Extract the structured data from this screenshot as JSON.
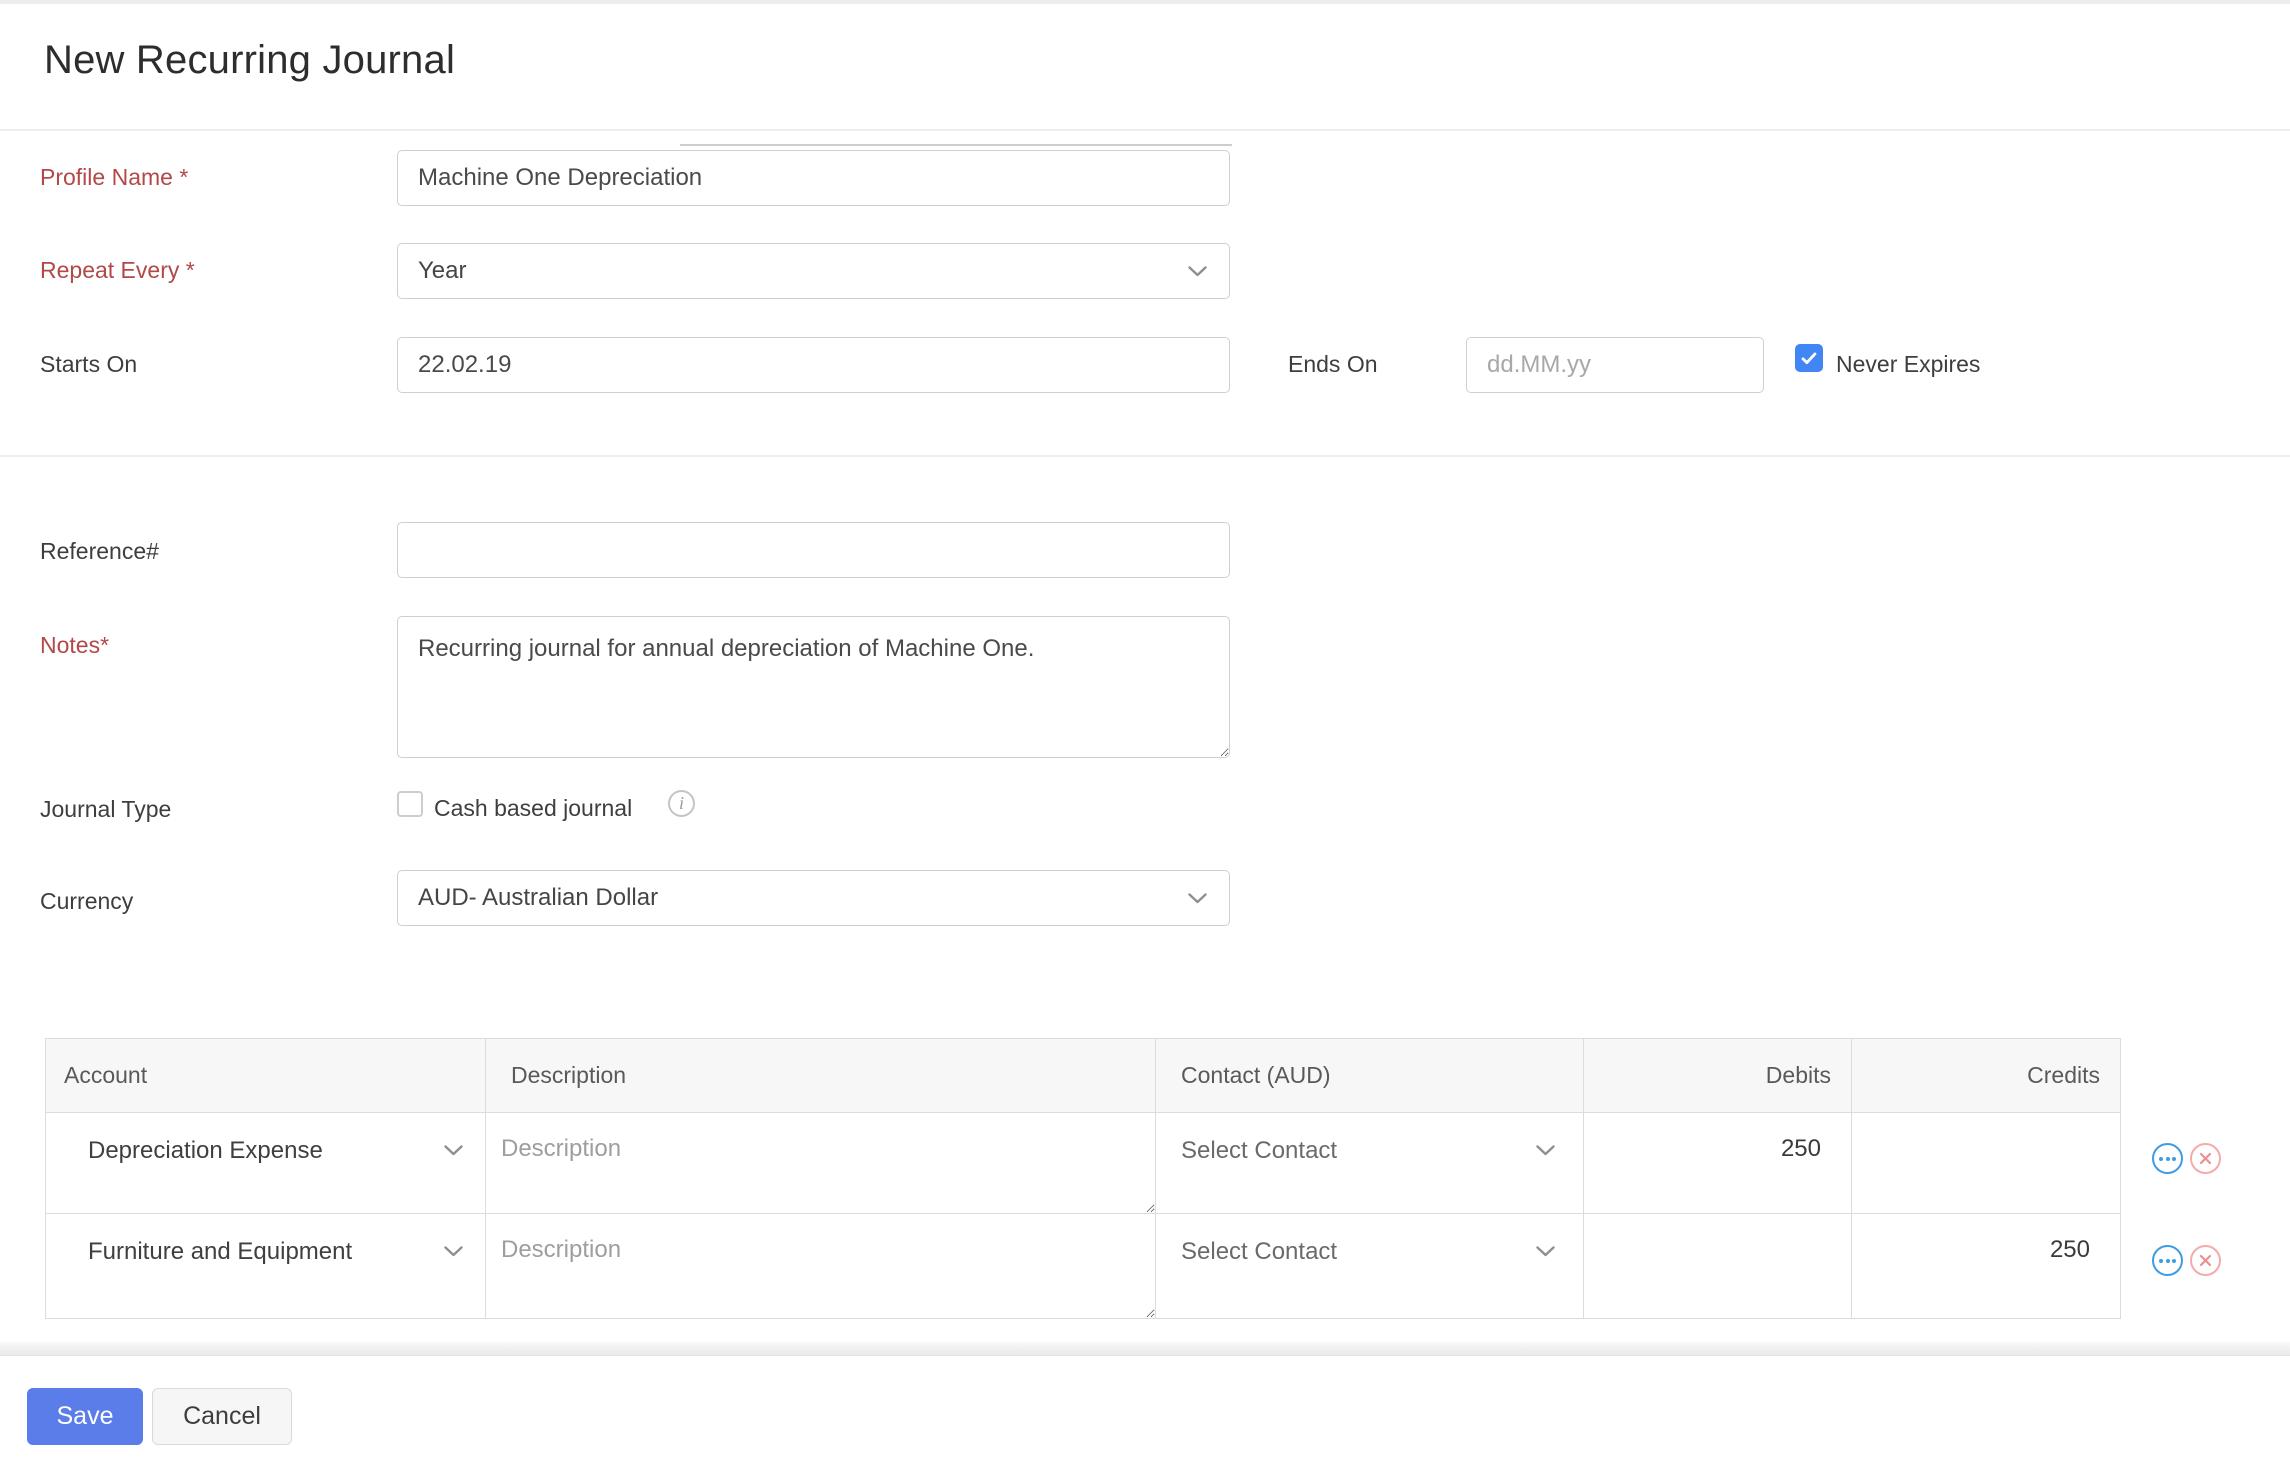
{
  "header": {
    "title": "New Recurring Journal"
  },
  "form": {
    "profile_name": {
      "label": "Profile Name *",
      "value": "Machine One Depreciation"
    },
    "repeat_every": {
      "label": "Repeat Every *",
      "value": "Year"
    },
    "starts_on": {
      "label": "Starts On",
      "value": "22.02.19"
    },
    "ends_on": {
      "label": "Ends On",
      "placeholder": "dd.MM.yy",
      "value": ""
    },
    "never_expires": {
      "label": "Never Expires",
      "checked": true
    },
    "reference": {
      "label": "Reference#",
      "value": ""
    },
    "notes": {
      "label": "Notes*",
      "value": "Recurring journal for annual depreciation of Machine One."
    },
    "journal_type": {
      "label": "Journal Type",
      "checkbox_label": "Cash based journal",
      "checked": false
    },
    "currency": {
      "label": "Currency",
      "value": "AUD- Australian Dollar"
    }
  },
  "table": {
    "headers": {
      "account": "Account",
      "description": "Description",
      "contact": "Contact (AUD)",
      "debits": "Debits",
      "credits": "Credits"
    },
    "rows": [
      {
        "account": "Depreciation Expense",
        "description_placeholder": "Description",
        "contact": "Select Contact",
        "debits": "250",
        "credits": ""
      },
      {
        "account": "Furniture and Equipment",
        "description_placeholder": "Description",
        "contact": "Select Contact",
        "debits": "",
        "credits": "250"
      }
    ]
  },
  "footer": {
    "save": "Save",
    "cancel": "Cancel"
  },
  "colors": {
    "required_label": "#b24848",
    "primary_button": "#5a7dea",
    "checkbox_checked": "#4285f4",
    "row_more_icon": "#3d9ce5",
    "row_remove_icon": "#f3abab"
  }
}
